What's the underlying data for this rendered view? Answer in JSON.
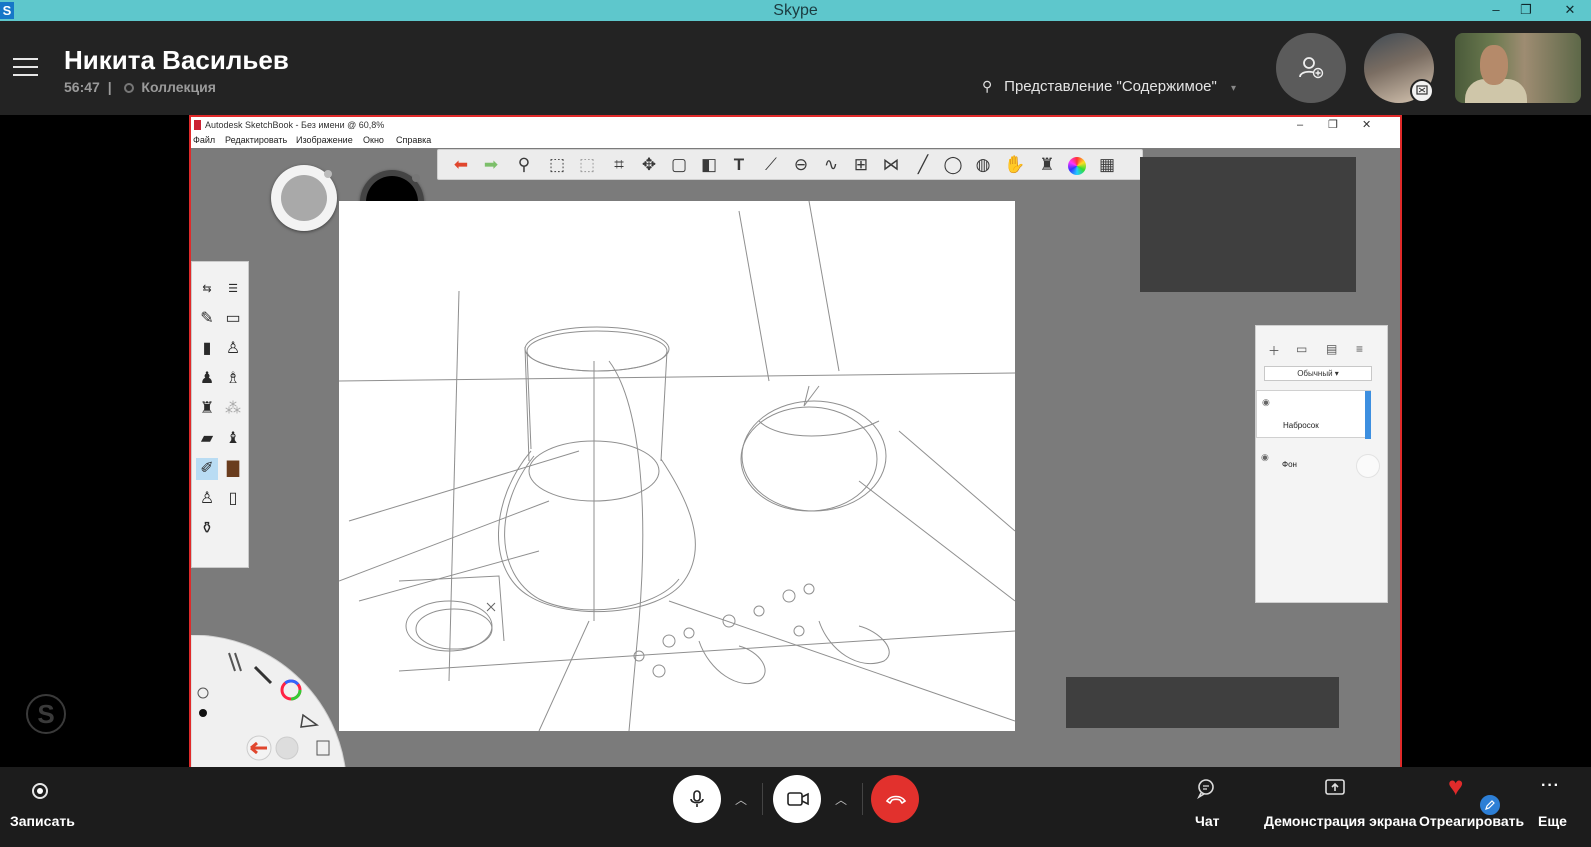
{
  "window": {
    "title": "Skype",
    "app_logo": "S",
    "minimize": "–",
    "restore": "❐",
    "close": "✕"
  },
  "call": {
    "contact_name": "Никита Васильев",
    "duration": "56:47",
    "separator": "|",
    "group_label": "Коллекция",
    "view_mode": "Представление \"Содержимое\""
  },
  "sketchbook": {
    "title": "Autodesk SketchBook - Без имени @ 60,8%",
    "menu": [
      "Файл",
      "Редактировать",
      "Изображение",
      "Окно",
      "Справка"
    ],
    "blend_mode": "Обычный",
    "layers": [
      {
        "name": "Набросок"
      },
      {
        "name": "Фон"
      }
    ],
    "accent_colors": {
      "share_border": "#e02a2a",
      "canvas_bg": "#ffffff",
      "workspace_bg": "#7b7b7b",
      "selected_layer": "#3d8fe0"
    }
  },
  "controls": {
    "record_label": "Записать",
    "chat_label": "Чат",
    "screen_share_label": "Демонстрация экрана",
    "react_label": "Отреагировать",
    "more_label": "Еще",
    "more_glyph": "···",
    "hangup_color": "#e2312d"
  },
  "icons": {
    "menu": "hamburger-icon",
    "add_person": "add-person-icon",
    "mic": "microphone-icon",
    "video": "camera-icon",
    "hangup": "hang-up-icon",
    "chat": "chat-icon",
    "share": "share-screen-icon",
    "react": "heart-icon"
  }
}
